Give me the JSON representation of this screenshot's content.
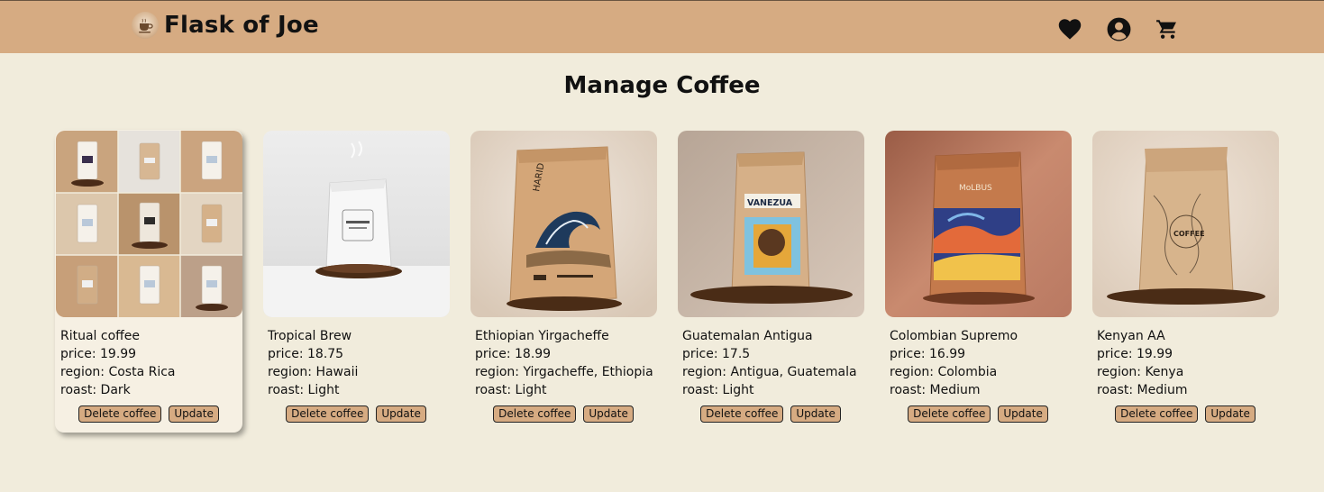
{
  "header": {
    "brand": "Flask of Joe",
    "brand_logo_icon": "coffee-cup-icon",
    "icons": [
      "heart-icon",
      "user-account-icon",
      "cart-icon"
    ],
    "background": "#d6ab82"
  },
  "page": {
    "title": "Manage Coffee",
    "background": "#f1ecdc"
  },
  "labels": {
    "delete": "Delete coffee",
    "update": "Update"
  },
  "coffees": [
    {
      "name": "Ritual coffee",
      "price": "price: 19.99",
      "region": "region: Costa Rica",
      "roast": "roast: Dark",
      "highlighted": true
    },
    {
      "name": "Tropical Brew",
      "price": "price: 18.75",
      "region": "region: Hawaii",
      "roast": "roast: Light"
    },
    {
      "name": "Ethiopian Yirgacheffe",
      "price": "price: 18.99",
      "region": "region: Yirgacheffe, Ethiopia",
      "roast": "roast: Light"
    },
    {
      "name": "Guatemalan Antigua",
      "price": "price: 17.5",
      "region": "region: Antigua, Guatemala",
      "roast": "roast: Light"
    },
    {
      "name": "Colombian Supremo",
      "price": "price: 16.99",
      "region": "region: Colombia",
      "roast": "roast: Medium"
    },
    {
      "name": "Kenyan AA",
      "price": "price: 19.99",
      "region": "region: Kenya",
      "roast": "roast: Medium"
    }
  ]
}
